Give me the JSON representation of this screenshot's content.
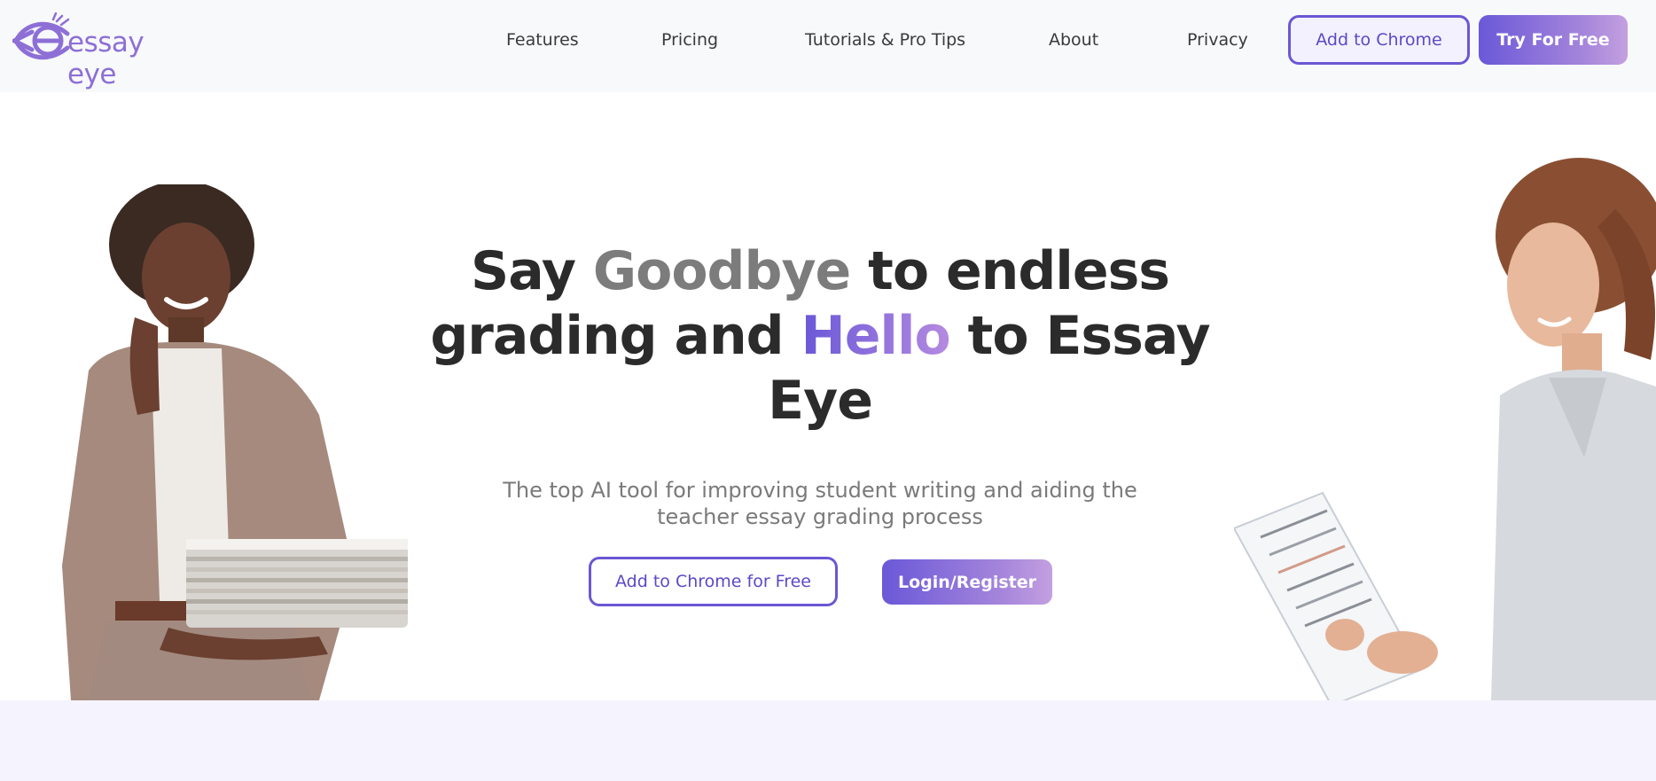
{
  "brand": {
    "name": "essay eye",
    "color": "#8d6fd6"
  },
  "nav": {
    "items": [
      {
        "label": "Features"
      },
      {
        "label": "Pricing"
      },
      {
        "label": "Tutorials & Pro Tips"
      },
      {
        "label": "About"
      },
      {
        "label": "Privacy"
      }
    ],
    "add_to_chrome": "Add to Chrome",
    "try_free": "Try For Free"
  },
  "hero": {
    "headline_1": "Say ",
    "headline_goodbye": "Goodbye",
    "headline_2": " to endless grading and ",
    "headline_hello": "Hello",
    "headline_3": " to Essay Eye",
    "subheadline": "The top AI tool for improving student writing and aiding the teacher essay grading process",
    "cta_chrome": "Add to Chrome for Free",
    "cta_login": "Login/Register"
  },
  "colors": {
    "accent": "#6b57d4",
    "accent_light": "#c3a0e0",
    "band": "#f5f3fe"
  },
  "icons": {
    "logo": "eye-logo-icon"
  }
}
